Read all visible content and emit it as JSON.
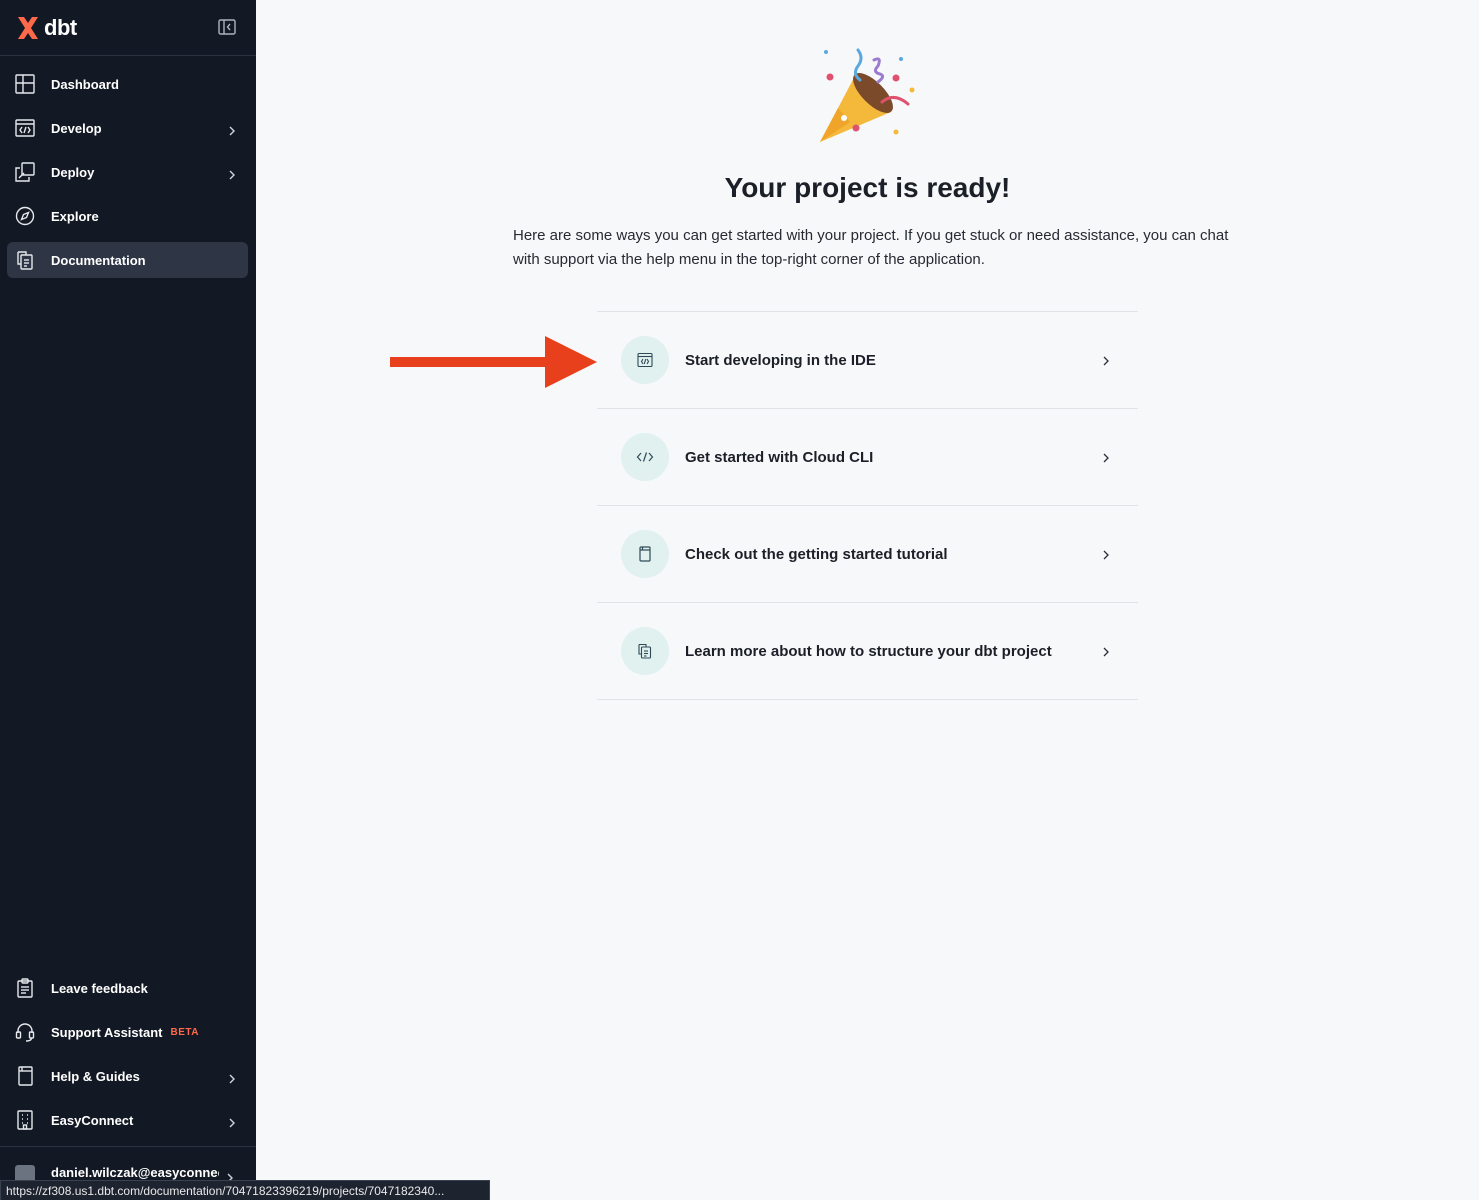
{
  "brand": {
    "name": "dbt",
    "color": "#ff694a"
  },
  "sidebar": {
    "top_items": [
      {
        "label": "Dashboard",
        "icon": "dashboard-icon",
        "has_chevron": false,
        "active": false
      },
      {
        "label": "Develop",
        "icon": "code-window-icon",
        "has_chevron": true,
        "active": false
      },
      {
        "label": "Deploy",
        "icon": "deploy-icon",
        "has_chevron": true,
        "active": false
      },
      {
        "label": "Explore",
        "icon": "compass-icon",
        "has_chevron": false,
        "active": false
      },
      {
        "label": "Documentation",
        "icon": "documents-icon",
        "has_chevron": false,
        "active": true
      }
    ],
    "bottom_items": [
      {
        "label": "Leave feedback",
        "icon": "clipboard-icon",
        "has_chevron": false
      },
      {
        "label": "Support Assistant",
        "icon": "headset-icon",
        "has_chevron": false,
        "badge": "BETA"
      },
      {
        "label": "Help & Guides",
        "icon": "book-icon",
        "has_chevron": true
      },
      {
        "label": "EasyConnect",
        "icon": "building-icon",
        "has_chevron": true
      }
    ],
    "user": {
      "email": "daniel.wilczak@easyconnec"
    }
  },
  "main": {
    "title": "Your project is ready!",
    "subtitle": "Here are some ways you can get started with your project. If you get stuck or need assistance, you can chat with support via the help menu in the top-right corner of the application.",
    "options": [
      {
        "label": "Start developing in the IDE",
        "icon": "code-window-icon"
      },
      {
        "label": "Get started with Cloud CLI",
        "icon": "code-brackets-icon"
      },
      {
        "label": "Check out the getting started tutorial",
        "icon": "book-icon"
      },
      {
        "label": "Learn more about how to structure your dbt project",
        "icon": "documents-icon"
      }
    ]
  },
  "annotation": {
    "arrow_color": "#e8401c"
  },
  "status_bar": {
    "url": "https://zf308.us1.dbt.com/documentation/70471823396219/projects/7047182340..."
  }
}
